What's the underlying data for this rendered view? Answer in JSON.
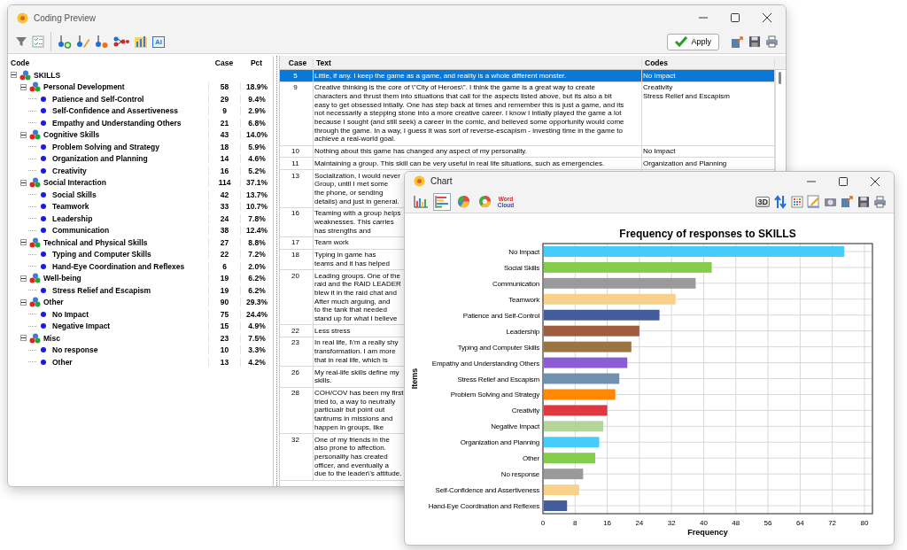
{
  "coding_window": {
    "title": "Coding Preview",
    "toolbar": {
      "ai_label": "AI",
      "apply_label": "Apply"
    },
    "tree": {
      "columns": [
        "Code",
        "Case",
        "Pct"
      ],
      "nodes": [
        {
          "label": "SKILLS",
          "expanded": true,
          "children": [
            {
              "label": "Personal Development",
              "case": "58",
              "pct": "18.9%",
              "expanded": true,
              "children": [
                {
                  "label": "Patience and Self-Control",
                  "case": "29",
                  "pct": "9.4%"
                },
                {
                  "label": "Self-Confidence and Assertiveness",
                  "case": "9",
                  "pct": "2.9%"
                },
                {
                  "label": "Empathy and Understanding Others",
                  "case": "21",
                  "pct": "6.8%"
                }
              ]
            },
            {
              "label": "Cognitive Skills",
              "case": "43",
              "pct": "14.0%",
              "expanded": true,
              "children": [
                {
                  "label": "Problem Solving and Strategy",
                  "case": "18",
                  "pct": "5.9%"
                },
                {
                  "label": "Organization and Planning",
                  "case": "14",
                  "pct": "4.6%"
                },
                {
                  "label": "Creativity",
                  "case": "16",
                  "pct": "5.2%"
                }
              ]
            },
            {
              "label": "Social Interaction",
              "case": "114",
              "pct": "37.1%",
              "expanded": true,
              "children": [
                {
                  "label": "Social Skills",
                  "case": "42",
                  "pct": "13.7%"
                },
                {
                  "label": "Teamwork",
                  "case": "33",
                  "pct": "10.7%"
                },
                {
                  "label": "Leadership",
                  "case": "24",
                  "pct": "7.8%"
                },
                {
                  "label": "Communication",
                  "case": "38",
                  "pct": "12.4%"
                }
              ]
            },
            {
              "label": "Technical and Physical Skills",
              "case": "27",
              "pct": "8.8%",
              "expanded": true,
              "children": [
                {
                  "label": "Typing and Computer Skills",
                  "case": "22",
                  "pct": "7.2%"
                },
                {
                  "label": "Hand-Eye Coordination and Reflexes",
                  "case": "6",
                  "pct": "2.0%"
                }
              ]
            },
            {
              "label": "Well-being",
              "case": "19",
              "pct": "6.2%",
              "expanded": true,
              "children": [
                {
                  "label": "Stress Relief and Escapism",
                  "case": "19",
                  "pct": "6.2%"
                }
              ]
            },
            {
              "label": "Other",
              "case": "90",
              "pct": "29.3%",
              "expanded": true,
              "children": [
                {
                  "label": "No Impact",
                  "case": "75",
                  "pct": "24.4%"
                },
                {
                  "label": "Negative Impact",
                  "case": "15",
                  "pct": "4.9%"
                }
              ]
            },
            {
              "label": "Misc",
              "case": "23",
              "pct": "7.5%",
              "expanded": true,
              "children": [
                {
                  "label": "No response",
                  "case": "10",
                  "pct": "3.3%"
                },
                {
                  "label": "Other",
                  "case": "13",
                  "pct": "4.2%"
                }
              ]
            }
          ]
        }
      ]
    },
    "table": {
      "columns": [
        "Case",
        "Text",
        "Codes"
      ],
      "rows": [
        {
          "case": "5",
          "selected": true,
          "lines": [
            "Little, if any. I keep the game as a game, and reality is a whole different monster."
          ],
          "codes": [
            "No Impact"
          ]
        },
        {
          "case": "9",
          "selected": false,
          "lines": [
            "Creative thinking is the core of \\\"City of Heroes\\\". I think the game is a great way to create",
            "characters and thrust them into situations that call for the aspects listed above, but its also a bit",
            "easy to get obsessed intially. One has step back at times and remember this is just a game, and its",
            "not necessarily a stepping stone into a more creative career. I know I intially played the game a lot",
            "because I sought (and still seek) a career in the comic, and believed some opportunity would come",
            "through the game. In a way, I guess it was sort of reverse-escapism - investing time in the game to",
            "achieve a real-world goal."
          ],
          "codes": [
            "Creativity",
            "Stress Relief and Escapism"
          ]
        },
        {
          "case": "10",
          "selected": false,
          "lines": [
            "Nothing about this game has changed any aspect of my personality."
          ],
          "codes": [
            "No Impact"
          ]
        },
        {
          "case": "11",
          "selected": false,
          "lines": [
            "Maintaining a group. This skill can be very useful in real life situations, such as emergencies."
          ],
          "codes": [
            "Organization and Planning"
          ]
        },
        {
          "case": "13",
          "selected": false,
          "lines": [
            "Socialization, I would never",
            "Group, until I met some",
            "the phone, or sending",
            "details) and just in general."
          ]
        },
        {
          "case": "16",
          "selected": false,
          "lines": [
            "Teaming with a group helps",
            "weaknesses.  This carries",
            "has strengths and"
          ]
        },
        {
          "case": "17",
          "selected": false,
          "lines": [
            "Team work"
          ]
        },
        {
          "case": "18",
          "selected": false,
          "lines": [
            "Typing in game has",
            "teams and it has helped"
          ]
        },
        {
          "case": "20",
          "selected": false,
          "lines": [
            "Leading groups. One of the",
            "raid and the RAID LEADER",
            "blew it in the raid chat and",
            "After much arguing, and",
            "to the tank that needed",
            "stand up for what I believe"
          ]
        },
        {
          "case": "22",
          "selected": false,
          "lines": [
            "Less stress"
          ]
        },
        {
          "case": "23",
          "selected": false,
          "lines": [
            "In real life, I\\'m a really shy",
            "transformation. I am more",
            "that in real life, which is"
          ]
        },
        {
          "case": "26",
          "selected": false,
          "lines": [
            "My real-life skills define my",
            "skills."
          ]
        },
        {
          "case": "28",
          "selected": false,
          "lines": [
            "COH/COV has been my first",
            "tried to, a way to neutrally",
            "particualr but point out",
            "tantrums in missions and",
            "happen in groups, like"
          ]
        },
        {
          "case": "32",
          "selected": false,
          "lines": [
            "One of my friends in the",
            "also prone to affection.",
            "personality has created",
            "officer, and eventually a",
            "due to the leader\\'s attitude."
          ]
        }
      ]
    }
  },
  "chart_window": {
    "title": "Chart",
    "three_d_label": "3D",
    "chart_types": [
      {
        "kind": "column",
        "selected": false
      },
      {
        "kind": "bar",
        "selected": true
      },
      {
        "kind": "pie",
        "selected": false
      },
      {
        "kind": "donut",
        "selected": false
      },
      {
        "kind": "word-cloud",
        "selected": false,
        "label": "Word Cloud"
      }
    ],
    "chart_data": {
      "type": "bar",
      "orientation": "horizontal",
      "title": "Frequency of responses to SKILLS",
      "xlabel": "Frequency",
      "ylabel": "Items",
      "xlim": [
        0,
        82
      ],
      "xticks": [
        0,
        8,
        16,
        24,
        32,
        40,
        48,
        56,
        64,
        72,
        80
      ],
      "categories": [
        "No Impact",
        "Social Skills",
        "Communication",
        "Teamwork",
        "Patience and Self-Control",
        "Leadership",
        "Typing and Computer Skills",
        "Empathy and Understanding Others",
        "Stress Relief and Escapism",
        "Problem Solving and Strategy",
        "Creativity",
        "Negative Impact",
        "Organization and Planning",
        "Other",
        "No response",
        "Self-Confidence and Assertiveness",
        "Hand-Eye Coordination and Reflexes"
      ],
      "values": [
        75,
        42,
        38,
        33,
        29,
        24,
        22,
        21,
        19,
        18,
        16,
        15,
        14,
        13,
        10,
        9,
        6
      ],
      "grid": true
    }
  }
}
